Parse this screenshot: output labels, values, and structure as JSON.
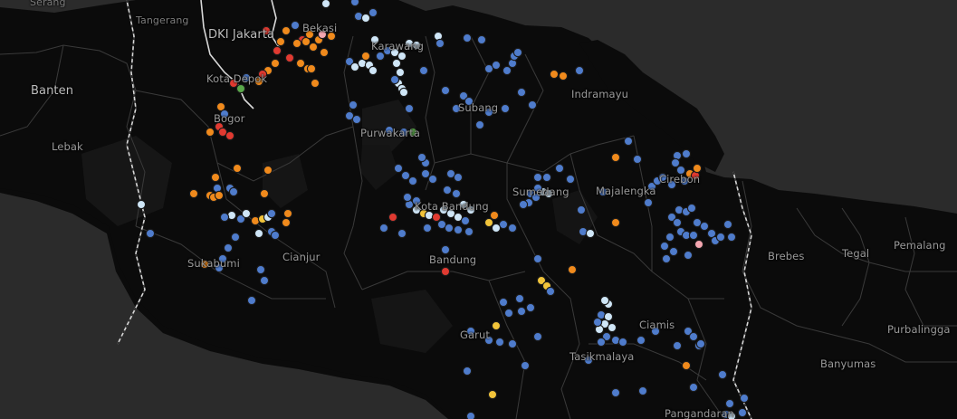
{
  "map": {
    "labels": [
      {
        "name": "Serang",
        "style": "dim"
      },
      {
        "name": "Tangerang",
        "style": "dim"
      },
      {
        "name": "DKI Jakarta",
        "style": "major"
      },
      {
        "name": "Bekasi",
        "style": ""
      },
      {
        "name": "Karawang",
        "style": ""
      },
      {
        "name": "Banten",
        "style": "major"
      },
      {
        "name": "Kota Depok",
        "style": ""
      },
      {
        "name": "Bogor",
        "style": ""
      },
      {
        "name": "Lebak",
        "style": ""
      },
      {
        "name": "Subang",
        "style": ""
      },
      {
        "name": "Indramayu",
        "style": ""
      },
      {
        "name": "Purwakarta",
        "style": ""
      },
      {
        "name": "Sumedang",
        "style": ""
      },
      {
        "name": "Majalengka",
        "style": ""
      },
      {
        "name": "Cirebon",
        "style": ""
      },
      {
        "name": "Bandung",
        "style": ""
      },
      {
        "name": "Kota Bandung",
        "style": ""
      },
      {
        "name": "Cianjur",
        "style": ""
      },
      {
        "name": "Sukabumi",
        "style": ""
      },
      {
        "name": "Garut",
        "style": ""
      },
      {
        "name": "Ciamis",
        "style": ""
      },
      {
        "name": "Tasikmalaya",
        "style": ""
      },
      {
        "name": "Brebes",
        "style": ""
      },
      {
        "name": "Tegal",
        "style": ""
      },
      {
        "name": "Pemalang",
        "style": ""
      },
      {
        "name": "Purbalingga",
        "style": ""
      },
      {
        "name": "Banyumas",
        "style": ""
      },
      {
        "name": "Pangandaran",
        "style": ""
      }
    ],
    "colors": {
      "background": "#2b2b2b",
      "land": "#0b0b0b",
      "border": "#3d3d3d",
      "province_border": "#c8c8c8",
      "dot_blue": "#4f7ccc",
      "dot_light": "#cfe6f7",
      "dot_orange": "#f08a1c",
      "dot_yellow": "#f2c43a",
      "dot_red": "#e03a31",
      "dot_green": "#5aa84a",
      "dot_pink": "#f4a6b0"
    }
  }
}
